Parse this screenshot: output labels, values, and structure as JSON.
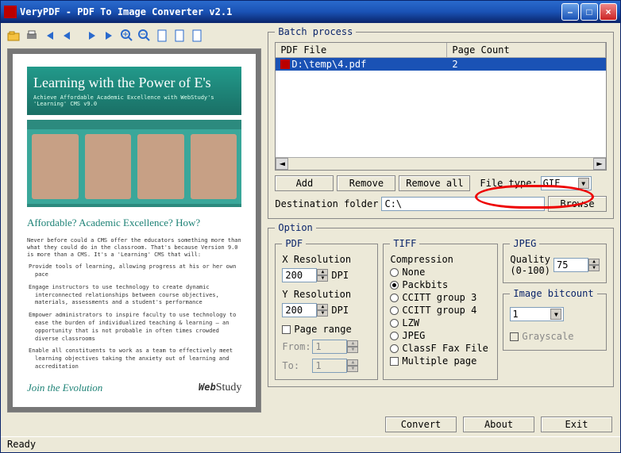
{
  "title": "VeryPDF - PDF To Image Converter v2.1",
  "status": "Ready",
  "toolbar": {
    "icons": [
      "open",
      "print",
      "first",
      "prev",
      "next",
      "last",
      "zoomin",
      "zoomout",
      "blank",
      "blank2",
      "blank3"
    ]
  },
  "preview": {
    "hero_title": "Learning with the Power of E's",
    "hero_sub": "Achieve Affordable Academic Excellence with WebStudy's 'Learning' CMS v9.0",
    "section_h": "Affordable? Academic Excellence? How?",
    "body1": "Never before could a CMS offer the educators something more than what they could do in the classroom. That's because Version 9.0 is more than a CMS. It's a 'Learning' CMS that will:",
    "bullets": [
      "Provide tools of learning, allowing progress at his or her own pace",
      "Engage instructors to use technology to create dynamic interconnected relationships between course objectives, materials, assessments and a student's performance",
      "Empower administrators to inspire faculty to use technology to ease the burden of individualized teaching & learning — an opportunity that is not probable in often times crowded diverse classrooms",
      "Enable all constituents to work as a team to effectively meet learning objectives taking the anxiety out of learning and accreditation"
    ],
    "join": "Join the  Evolution",
    "logo": "WebStudy"
  },
  "batch": {
    "legend": "Batch process",
    "col_file": "PDF File",
    "col_count": "Page Count",
    "rows": [
      {
        "file": "D:\\temp\\4.pdf",
        "count": "2"
      }
    ],
    "btn_add": "Add",
    "btn_remove": "Remove",
    "btn_removeall": "Remove all",
    "filetype_label": "File type:",
    "filetype_value": "GIF",
    "dest_label": "Destination folder",
    "dest_value": "C:\\",
    "btn_browse": "Browse"
  },
  "option": {
    "legend": "Option",
    "pdf": {
      "legend": "PDF",
      "xres": "X Resolution",
      "xres_val": "200",
      "yres": "Y Resolution",
      "yres_val": "200",
      "dpi": "DPI",
      "pagerange": "Page range",
      "from": "From:",
      "from_val": "1",
      "to": "To:",
      "to_val": "1"
    },
    "tiff": {
      "legend": "TIFF",
      "compression": "Compression",
      "opts": [
        "None",
        "Packbits",
        "CCITT group 3",
        "CCITT group 4",
        "LZW",
        "JPEG",
        "ClassF Fax File"
      ],
      "selected": 1,
      "multipage": "Multiple page"
    },
    "jpeg": {
      "legend": "JPEG",
      "quality_label": "Quality",
      "quality_range": "(0-100)",
      "quality_val": "75"
    },
    "bitcount": {
      "legend": "Image bitcount",
      "value": "1",
      "grayscale": "Grayscale"
    }
  },
  "footer": {
    "convert": "Convert",
    "about": "About",
    "exit": "Exit"
  }
}
